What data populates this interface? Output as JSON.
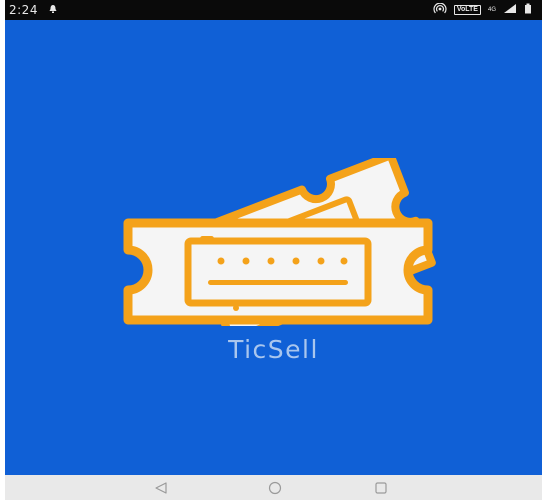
{
  "status_bar": {
    "time": "2:24",
    "network_badge": "VoLTE",
    "network_type": "4G",
    "icons": [
      "notification-icon",
      "hotspot-icon",
      "volte-icon",
      "signal-icon",
      "battery-icon"
    ]
  },
  "splash": {
    "app_name": "TicSell",
    "logo_icon": "ticket-icon",
    "colors": {
      "background": "#1060d6",
      "logo_stroke": "#f4a21a",
      "logo_fill": "#f5f5f5",
      "app_name": "#a9c6ee"
    }
  },
  "navigation_bar": {
    "buttons": [
      "back-icon",
      "home-icon",
      "recents-icon"
    ]
  }
}
